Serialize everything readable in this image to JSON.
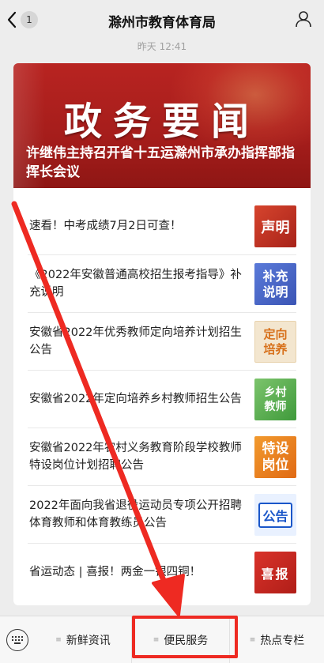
{
  "nav": {
    "title": "滁州市教育体育局",
    "unread_count": "1"
  },
  "timestamp": "昨天 12:41",
  "banner": {
    "title": "政务要闻",
    "headline": "许继伟主持召开省十五运滁州市承办指挥部指挥长会议"
  },
  "news": [
    {
      "text": "速看！中考成绩7月2日可查！",
      "thumb": "声明"
    },
    {
      "text": "《2022年安徽普通高校招生报考指导》补充说明",
      "thumb": "补充说明"
    },
    {
      "text": "安徽省2022年优秀教师定向培养计划招生公告",
      "thumb": "定向培养"
    },
    {
      "text": "安徽省2022年定向培养乡村教师招生公告",
      "thumb": "乡村教师"
    },
    {
      "text": "安徽省2022年农村义务教育阶段学校教师特设岗位计划招聘公告",
      "thumb": "特设岗位"
    },
    {
      "text": "2022年面向我省退役运动员专项公开招聘体育教师和体育教练员公告",
      "thumb": "公告"
    },
    {
      "text": "省运动态 | 喜报！两金一银四铜！",
      "thumb": "喜报"
    }
  ],
  "thumb_lines": {
    "buchong": [
      "补充",
      "说明"
    ],
    "dingxiang": [
      "定向",
      "培养"
    ],
    "xiangcun": [
      "乡村",
      "教师"
    ],
    "tese": [
      "特设",
      "岗位"
    ]
  },
  "menu": {
    "tab1": "新鲜资讯",
    "tab2": "便民服务",
    "tab3": "热点专栏"
  },
  "annotation": {
    "color": "#ee2a22"
  }
}
